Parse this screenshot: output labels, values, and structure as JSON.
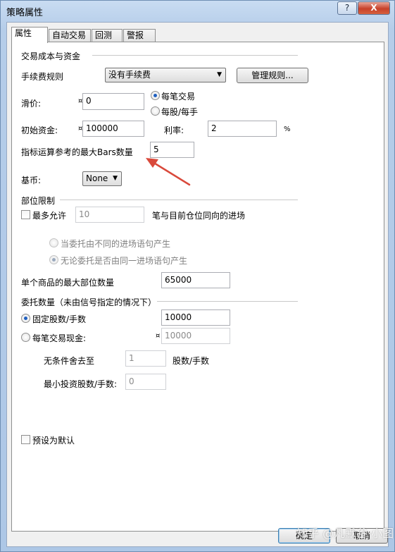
{
  "window": {
    "title": "策略属性",
    "help_label": "?",
    "close_label": "X"
  },
  "tabs": [
    {
      "label": "属性",
      "active": true
    },
    {
      "label": "自动交易",
      "active": false
    },
    {
      "label": "回测",
      "active": false
    },
    {
      "label": "警报",
      "active": false
    }
  ],
  "cost": {
    "group_label": "交易成本与资金",
    "fee_rule_label": "手续费规则",
    "fee_rule_value": "没有手续费",
    "manage_rules_label": "管理规则...",
    "slippage_label": "滑价:",
    "currency_symbol": "¤",
    "slippage_value": "0",
    "per_trade_label": "每笔交易",
    "per_share_label": "每股/每手",
    "capital_label": "初始资金:",
    "capital_value": "100000",
    "rate_label": "利率:",
    "rate_value": "2",
    "percent_label": "%",
    "max_bars_label": "指标运算参考的最大Bars数量",
    "max_bars_value": "5",
    "base_currency_label": "基币:",
    "base_currency_value": "None"
  },
  "position": {
    "group_label": "部位限制",
    "max_allow_label": "最多允许",
    "max_allow_value": "10",
    "max_allow_suffix": "笔与目前仓位同向的进场",
    "radio_diff_label": "当委托由不同的进场语句产生",
    "radio_any_label": "无论委托是否由同一进场语句产生",
    "max_position_label": "单个商品的最大部位数量",
    "max_position_value": "65000"
  },
  "order": {
    "group_label": "委托数量（未由信号指定的情况下）",
    "fixed_label": "固定股数/手数",
    "fixed_value": "10000",
    "cash_label": "每笔交易现金:",
    "cash_value": "10000",
    "round_label": "无条件舍去至",
    "round_value": "1",
    "round_suffix": "股数/手数",
    "min_label": "最小投资股数/手数:",
    "min_value": "0"
  },
  "default_label": "预设为默认",
  "footer": {
    "ok_label": "确定",
    "cancel_label": "取消"
  },
  "watermark": "知乎 @凡默谷·小图"
}
